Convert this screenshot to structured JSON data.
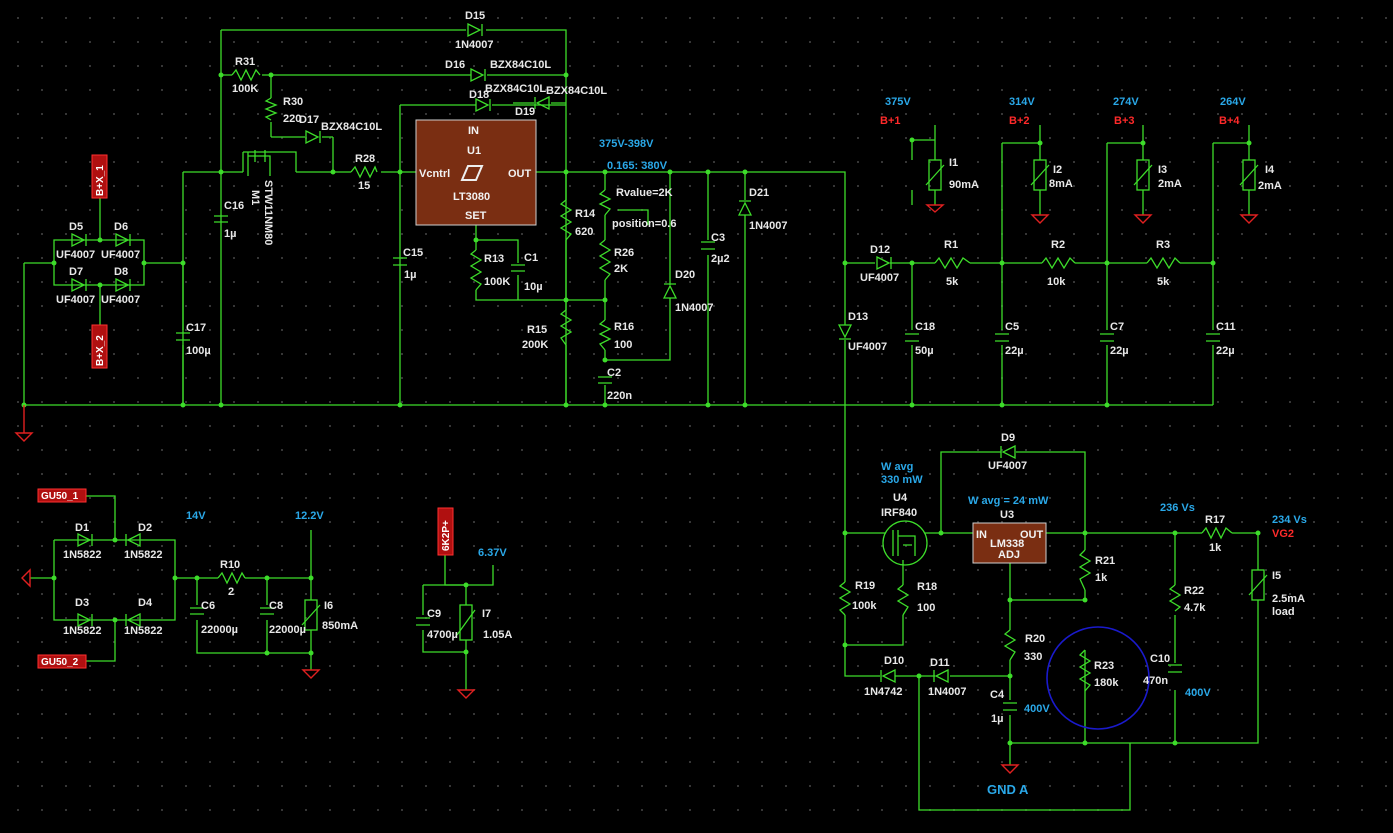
{
  "diagram": {
    "ic": {
      "u1": {
        "name": "U1",
        "part": "LT3080",
        "in": "IN",
        "out": "OUT",
        "vctrl": "Vcntrl",
        "set": "SET"
      },
      "u3": {
        "name": "U3",
        "part": "LM338",
        "in": "IN",
        "out": "OUT",
        "adj": "ADJ"
      },
      "u4": {
        "name": "U4",
        "part": "IRF840"
      },
      "m1": {
        "name": "M1",
        "part": "STW11NM80"
      }
    },
    "labels": {
      "D15": "D15",
      "D15v": "1N4007",
      "D16": "D16",
      "D16v": "BZX84C10L",
      "D18": "D18",
      "D18v": "BZX84C10L",
      "D19": "D19",
      "D19v": "BZX84C10L",
      "D17": "D17",
      "D17v": "BZX84C10L",
      "R31": "R31",
      "R31v": "100K",
      "R30": "R30",
      "R30v": "220",
      "R28": "R28",
      "R28v": "15",
      "C16": "C16",
      "C16v": "1µ",
      "C15": "C15",
      "C15v": "1µ",
      "C17": "C17",
      "C17v": "100µ",
      "R13": "R13",
      "R13v": "100K",
      "C1": "C1",
      "C1v": "10µ",
      "R14": "R14",
      "R14v": "620",
      "R26": "R26",
      "R26v": "2K",
      "R16": "R16",
      "R16v": "100",
      "R15": "R15",
      "R15v": "200K",
      "C2": "C2",
      "C2v": "220n",
      "C3": "C3",
      "C3v": "2µ2",
      "D20": "D20",
      "D20v": "1N4007",
      "D21": "D21",
      "D21v": "1N4007",
      "rvalue": "Rvalue=2K",
      "position": "position=0.6",
      "D5": "D5",
      "D5v": "UF4007",
      "D6": "D6",
      "D6v": "UF4007",
      "D7": "D7",
      "D7v": "UF4007",
      "D8": "D8",
      "D8v": "UF4007",
      "D12": "D12",
      "D12v": "UF4007",
      "D13": "D13",
      "D13v": "UF4007",
      "R1": "R1",
      "R1v": "5k",
      "R2": "R2",
      "R2v": "10k",
      "R3": "R3",
      "R3v": "5k",
      "C18": "C18",
      "C18v": "50µ",
      "C5": "C5",
      "C5v": "22µ",
      "C7": "C7",
      "C7v": "22µ",
      "C11": "C11",
      "C11v": "22µ",
      "I1": "I1",
      "I1v": "90mA",
      "I2": "I2",
      "I2v": "8mA",
      "I3": "I3",
      "I3v": "2mA",
      "I4": "I4",
      "I4v": "2mA",
      "D1": "D1",
      "D1v": "1N5822",
      "D2": "D2",
      "D2v": "1N5822",
      "D3": "D3",
      "D3v": "1N5822",
      "D4": "D4",
      "D4v": "1N5822",
      "R10": "R10",
      "R10v": "2",
      "C6": "C6",
      "C6v": "22000µ",
      "C8": "C8",
      "C8v": "22000µ",
      "I6": "I6",
      "I6v": "850mA",
      "C9": "C9",
      "C9v": "4700µ",
      "I7": "I7",
      "I7v": "1.05A",
      "D9": "D9",
      "D9v": "UF4007",
      "R19": "R19",
      "R19v": "100k",
      "R18": "R18",
      "R18v": "100",
      "D10": "D10",
      "D10v": "1N4742",
      "D11": "D11",
      "D11v": "1N4007",
      "R21": "R21",
      "R21v": "1k",
      "R20": "R20",
      "R20v": "330",
      "R23": "R23",
      "R23v": "180k",
      "C4": "C4",
      "C4v": "1µ",
      "C10": "C10",
      "C10v": "470n",
      "R22": "R22",
      "R22v": "4.7k",
      "R17": "R17",
      "R17v": "1k",
      "I5": "I5",
      "I5v": "2.5mA",
      "I5v2": "load"
    },
    "voltages": {
      "v375": "375V",
      "v314": "314V",
      "v274": "274V",
      "v264": "264V",
      "range": "375V-398V",
      "sweep": "0.165: 380V",
      "v14": "14V",
      "v122": "12.2V",
      "v637": "6.37V",
      "vs236": "236 Vs",
      "vs234": "234 Vs",
      "c4v": "400V",
      "c10v": "400V",
      "wavg4": "W avg",
      "wavg4b": "330 mW",
      "wavg3": "W avg =  24 mW",
      "gnda": "GND A"
    },
    "nets": {
      "bp1": "B+1",
      "bp2": "B+2",
      "bp3": "B+3",
      "bp4": "B+4",
      "vg2": "VG2",
      "bx1": "B+X_1",
      "bx2": "B+X_2",
      "gu1": "GU50_1",
      "gu2": "GU50_2",
      "gp": "6K2P+"
    },
    "colors": {
      "wire": "#3ddc2a",
      "label": "#e8e8e8",
      "annotation": "#2aa8e8",
      "net": "#ff2a2a",
      "chip": "#7a2e12",
      "highlight": "#1a1acc"
    }
  }
}
